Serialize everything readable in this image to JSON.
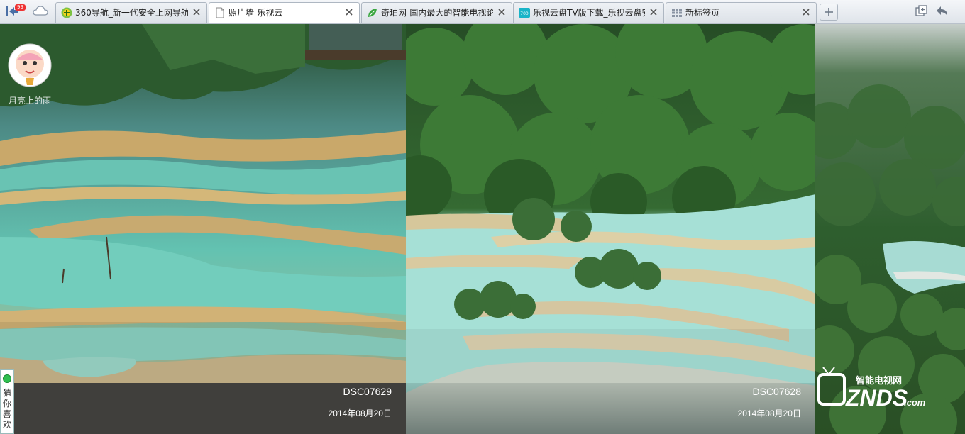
{
  "browser": {
    "mail_badge": "99",
    "tabs": [
      {
        "title": "360导航_新一代安全上网导航",
        "active": false,
        "icon": "360-logo-icon"
      },
      {
        "title": "照片墙-乐视云",
        "active": true,
        "icon": "page-icon"
      },
      {
        "title": "奇珀网-国内最大的智能电视论",
        "active": false,
        "icon": "qipo-leaf-icon"
      },
      {
        "title": "乐视云盘TV版下载_乐视云盘安",
        "active": false,
        "icon": "znds-700-icon"
      },
      {
        "title": "新标签页",
        "active": false,
        "icon": "grid-icon"
      }
    ],
    "new_tab_icon": "plus-icon",
    "right_icons": [
      "restore-window-icon",
      "undo-close-icon"
    ]
  },
  "user": {
    "name": "月亮上的雨",
    "avatar": "cartoon-baby-avatar"
  },
  "photos": [
    {
      "title": "DSC07629",
      "date": "2014年08月20日"
    },
    {
      "title": "DSC07628",
      "date": "2014年08月20日"
    }
  ],
  "guess_panel": {
    "label": "猜你喜欢",
    "chars": [
      "猜",
      "你",
      "喜",
      "欢"
    ]
  },
  "watermark": {
    "text_top": "智能电视网",
    "text_main": "ZNDS",
    "text_suffix": ".com"
  },
  "colors": {
    "pool_turquoise": "#7fd1c4",
    "forest_green": "#2f5a2a",
    "caption_bg": "#373737"
  }
}
